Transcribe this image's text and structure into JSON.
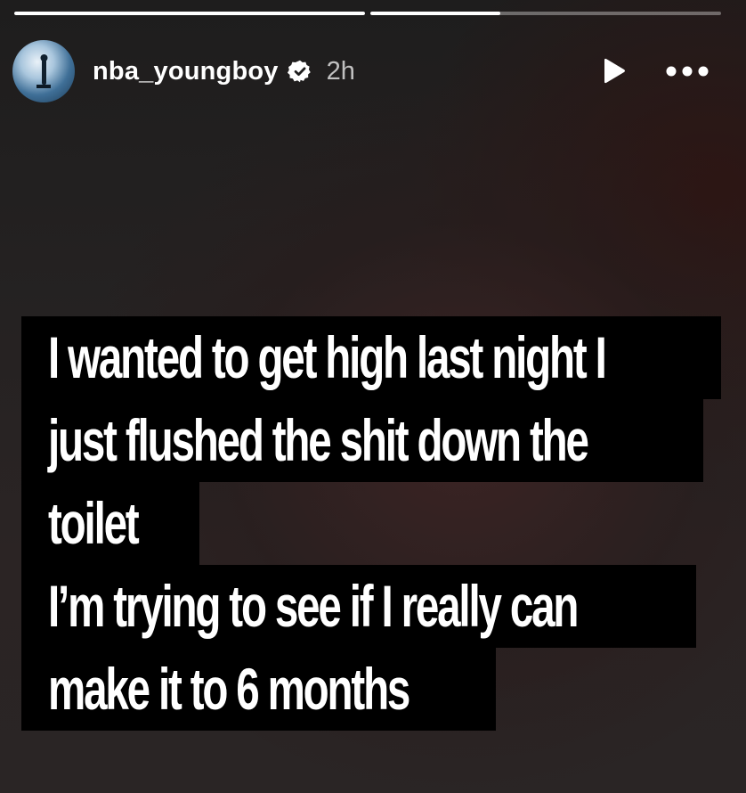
{
  "story": {
    "progress": [
      1.0,
      0.37
    ],
    "user": {
      "username": "nba_youngboy",
      "verified": true,
      "time_ago": "2h"
    },
    "controls": {
      "play_icon": "play-icon",
      "more_icon": "more-options-icon"
    },
    "caption_lines": [
      "I wanted to get high last night I",
      "just flushed the shit down the",
      "toilet",
      "I’m trying to see if I really can",
      "make it to 6 months"
    ],
    "colors": {
      "caption_background": "#000000",
      "caption_text": "#ffffff",
      "verified_badge": "#ffffff"
    }
  }
}
